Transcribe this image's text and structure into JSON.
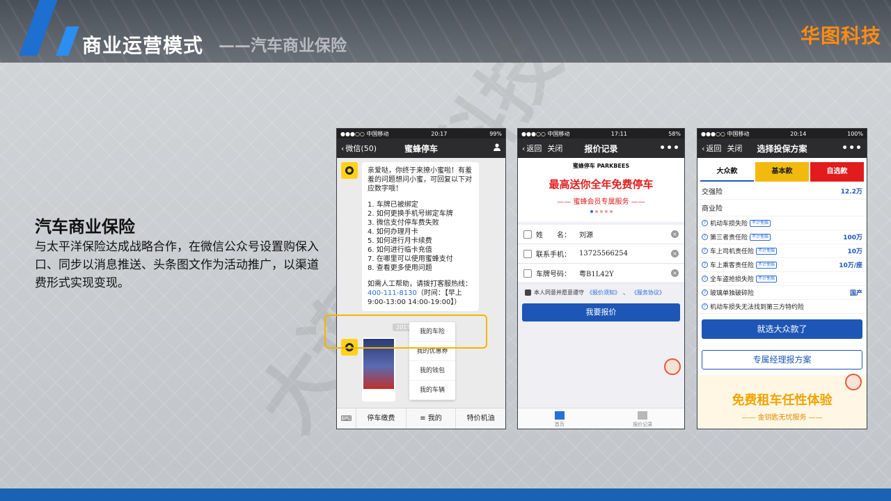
{
  "header": {
    "title": "商业运营模式",
    "subtitle": "——汽车商业保险",
    "brand": "华图科技"
  },
  "watermark": "大连华图科技",
  "section": {
    "heading": "汽车商业保险",
    "body": "与太平洋保险达成战略合作，在微信公众号设置购保入口、同步以消息推送、头条图文作为活动推广，以渠道费形式实现变现。"
  },
  "phone1": {
    "status_left": "●●●○○ 中国移动 ",
    "status_time": "20:17",
    "status_right": "99%",
    "back_label": "微信(50)",
    "title": "蜜蜂停车",
    "bubble_intro": "亲爱哒，你终于来撩小蜜啦！有羞羞的问题想问小蜜，可回复以下对应数字哦！",
    "menu_lines": [
      "1. 车牌已被绑定",
      "2. 如何更换手机号绑定车牌",
      "3. 微信支付停车费失败",
      "4. 如何办理月卡",
      "5. 如何进行月卡续费",
      "6. 如何进行临卡充值",
      "7. 在哪里可以使用蜜蜂支付",
      "8. 查看更多使用问题"
    ],
    "help_prefix": "如需人工帮助，请拨打客服热线：",
    "hotline": "400-111-8130",
    "help_suffix": "（时间：【早上9:00-13:00 14:00-19:00】）",
    "date_chip": "2017",
    "popup_items": [
      "我的车险",
      "我的优惠券",
      "我的钱包",
      "我的车辆"
    ],
    "tabbar": [
      "停车缴费",
      "≡ 我的",
      "特价机油"
    ]
  },
  "phone2": {
    "status_left": "●●●○○ 中国移动 ",
    "status_time": "17:11",
    "status_right": "58%",
    "back_label": "返回",
    "close_label": "关闭",
    "title": "报价记录",
    "banner_logo": "蜜蜂停车 PARKBEES",
    "banner_headline": "最高送你全年免费停车",
    "banner_sub": "—— 蜜蜂会员专属服务 ——",
    "fields": [
      {
        "label": "姓　　名：",
        "value": "刘源"
      },
      {
        "label": "联系手机：",
        "value": "13725566254"
      },
      {
        "label": "车牌号码：",
        "value": "粤B1L42Y"
      }
    ],
    "agree_prefix": "本人同意并愿意遵守",
    "agree_link1": "《报价须知》",
    "agree_sep": "、",
    "agree_link2": "《服务协议》",
    "submit": "我要报价",
    "bottom_tabs": [
      "首页",
      "报价记录"
    ]
  },
  "phone3": {
    "status_left": "●●●○○ 中国移动 ",
    "status_time": "20:14",
    "status_right": "100%",
    "back_label": "返回",
    "close_label": "关闭",
    "title": "选择投保方案",
    "plans": [
      "大众款",
      "基本款",
      "自选款"
    ],
    "compulsory_label": "交强险",
    "compulsory_amount": "12.2万",
    "commercial_label": "商业险",
    "items": [
      {
        "name": "机动车损失险",
        "tag": "不计免赔",
        "amount": ""
      },
      {
        "name": "第三者责任险",
        "tag": "不计免赔",
        "amount": "100万"
      },
      {
        "name": "车上司机责任险",
        "tag": "不计免赔",
        "amount": "10万"
      },
      {
        "name": "车上乘客责任险",
        "tag": "不计免赔",
        "amount": "10万/座"
      },
      {
        "name": "全车盗抢损失险",
        "tag": "不计免赔",
        "amount": ""
      },
      {
        "name": "玻璃单独破碎险",
        "tag": "",
        "amount": "国产"
      },
      {
        "name": "机动车损失无法找到第三方特约险",
        "tag": "",
        "amount": ""
      }
    ],
    "cta_primary": "就选大众款了",
    "cta_secondary": "专属经理报方案",
    "promo_big": "免费租车任性体验",
    "promo_small": "—— 金钥匙无忧服务 ——"
  },
  "colors": {
    "accent_blue": "#1d56b5",
    "brand_orange": "#ff8c14",
    "highlight_yellow": "#f5b400"
  }
}
